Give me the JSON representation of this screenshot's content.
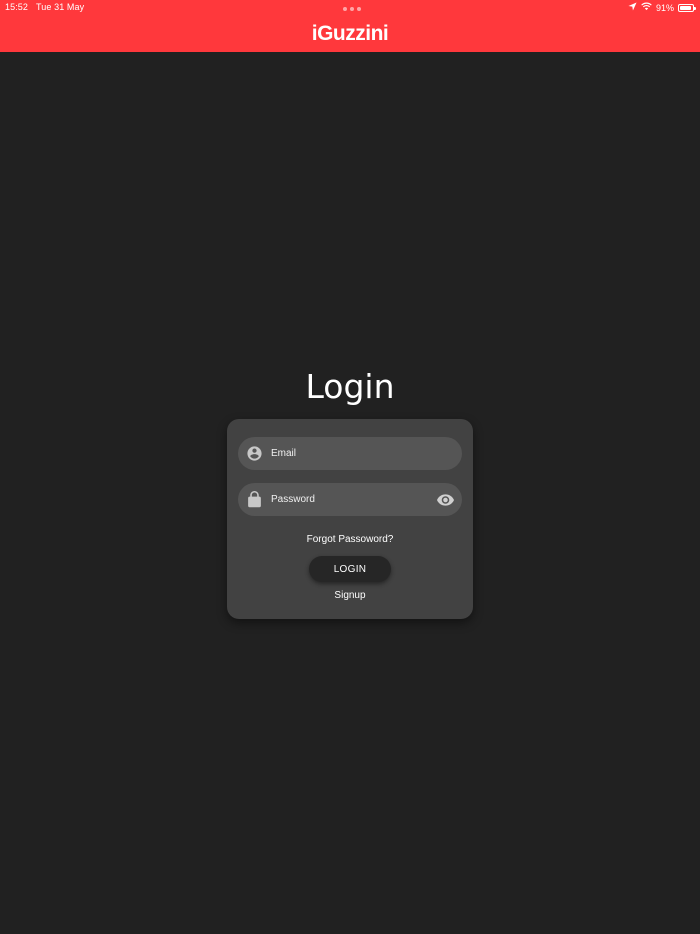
{
  "status_bar": {
    "time": "15:52",
    "date": "Tue 31 May",
    "battery": "91%",
    "battery_level": 0.91
  },
  "header": {
    "logo": "iGuzzini",
    "background": "#ff383c"
  },
  "login": {
    "title": "Login",
    "email_placeholder": "Email",
    "password_placeholder": "Password",
    "forgot_label": "Forgot Passoword?",
    "login_label": "LOGIN",
    "signup_label": "Signup"
  },
  "icons": {
    "email": "account-circle-icon",
    "password": "lock-icon",
    "toggle": "eye-icon"
  }
}
